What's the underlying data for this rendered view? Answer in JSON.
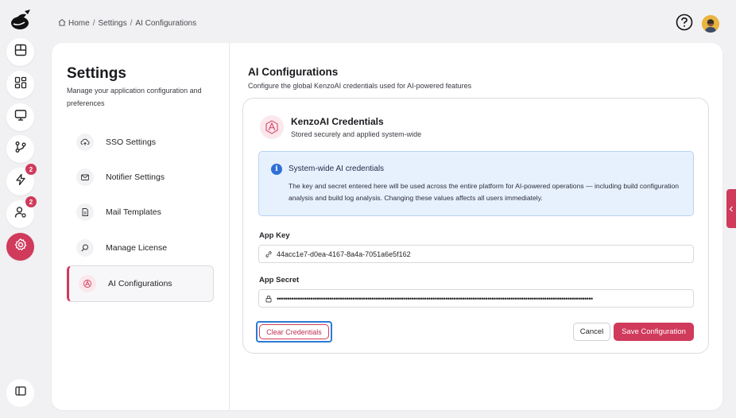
{
  "breadcrumb": {
    "home": "Home",
    "settings": "Settings",
    "current": "AI Configurations"
  },
  "rail": {
    "badge_deploy": "2",
    "badge_users": "2"
  },
  "sidebar": {
    "title": "Settings",
    "subtitle": "Manage your application configuration and preferences",
    "items": [
      {
        "label": "SSO Settings",
        "icon": "cloud-sync-icon"
      },
      {
        "label": "Notifier Settings",
        "icon": "mail-icon"
      },
      {
        "label": "Mail Templates",
        "icon": "document-icon"
      },
      {
        "label": "Manage License",
        "icon": "search-icon"
      },
      {
        "label": "AI Configurations",
        "icon": "ai-logo-icon",
        "active": true
      }
    ]
  },
  "content": {
    "title": "AI Configurations",
    "subtitle": "Configure the global KenzoAI credentials used for AI-powered features"
  },
  "credentials": {
    "title": "KenzoAI Credentials",
    "subtitle": "Stored securely and applied system-wide",
    "info_title": "System-wide AI credentials",
    "info_text": "The key and secret entered here will be used across the entire platform for AI-powered operations — including build configuration analysis and build log analysis. Changing these values affects all users immediately.",
    "app_key_label": "App Key",
    "app_key_value": "44acc1e7-d0ea-4167-8a4a-7051a6e5f162",
    "app_secret_label": "App Secret",
    "app_secret_value": "••••••••••••••••••••••••••••••••••••••••••••••••••••••••••••••••••••••••••••••••••••••••••••••••••••••••••••••••••••••••••••••••••••••••••••••••••••••",
    "clear_label": "Clear Credentials",
    "cancel_label": "Cancel",
    "save_label": "Save Configuration"
  },
  "colors": {
    "accent": "#d03a5b",
    "info_bg": "#e7f1fd",
    "info_icon": "#2f6fd8",
    "focus_ring": "#2a7bd6"
  }
}
